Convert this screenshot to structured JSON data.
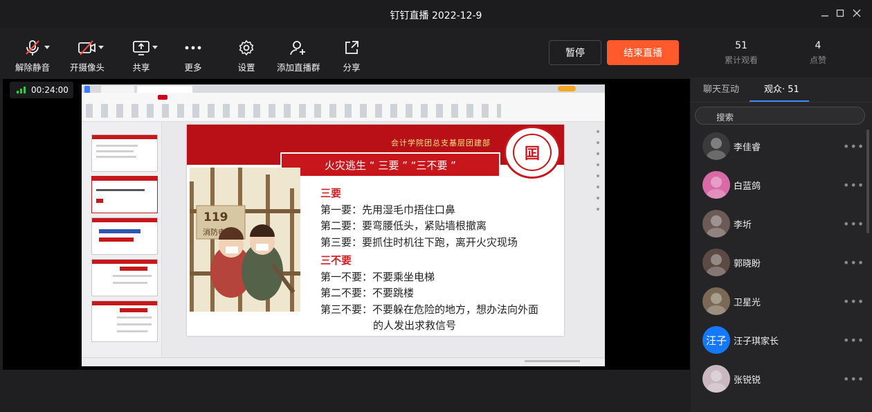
{
  "window": {
    "title": "钉钉直播 2022-12-9"
  },
  "toolbar": {
    "unmute": "解除静音",
    "camera": "开摄像头",
    "share": "共享",
    "more": "更多",
    "settings": "设置",
    "add_group": "添加直播群",
    "share_link": "分享",
    "pause": "暂停",
    "end": "结束直播"
  },
  "stats": {
    "views_count": "51",
    "views_label": "累计观看",
    "likes_count": "4",
    "likes_label": "点赞"
  },
  "stage": {
    "timer": "00:24:00"
  },
  "slide": {
    "org": "会计学院团总支基层团建部",
    "banner": "火灾逃生 “ 三要 ” “三不要 ”",
    "seal_char": "囸",
    "section1": "三要",
    "lines1": [
      "第一要：先用湿毛巾捂住口鼻",
      "第二要：要弯腰低头，紧贴墙根撤离",
      "第三要：要抓住时机往下跑，离开火灾现场"
    ],
    "section2": "三不要",
    "lines2": [
      "第一不要：不要乘坐电梯",
      "第二不要：不要跳楼",
      "第三不要：不要躲在危险的地方，想办法向外面"
    ],
    "line2_cont": "的人发出求救信号",
    "phone_number": "119",
    "phone_label": "消防电话"
  },
  "panel": {
    "tab_chat": "聊天互动",
    "tab_audience": "观众· 51",
    "search_placeholder": "搜索",
    "viewers": [
      {
        "name": "李佳睿",
        "color": "#3a3a3a"
      },
      {
        "name": "白蓝鸽",
        "color": "#d96aa8"
      },
      {
        "name": "李圻",
        "color": "#6b5a55"
      },
      {
        "name": "郭晓盼",
        "color": "#5c4a44"
      },
      {
        "name": "卫星光",
        "color": "#7a6a55"
      },
      {
        "name": "汪子琪家长",
        "color": "#1677ff",
        "initials": "汪子"
      },
      {
        "name": "张锐锐",
        "color": "#c9b8c0"
      }
    ],
    "more_glyph": "•••"
  }
}
